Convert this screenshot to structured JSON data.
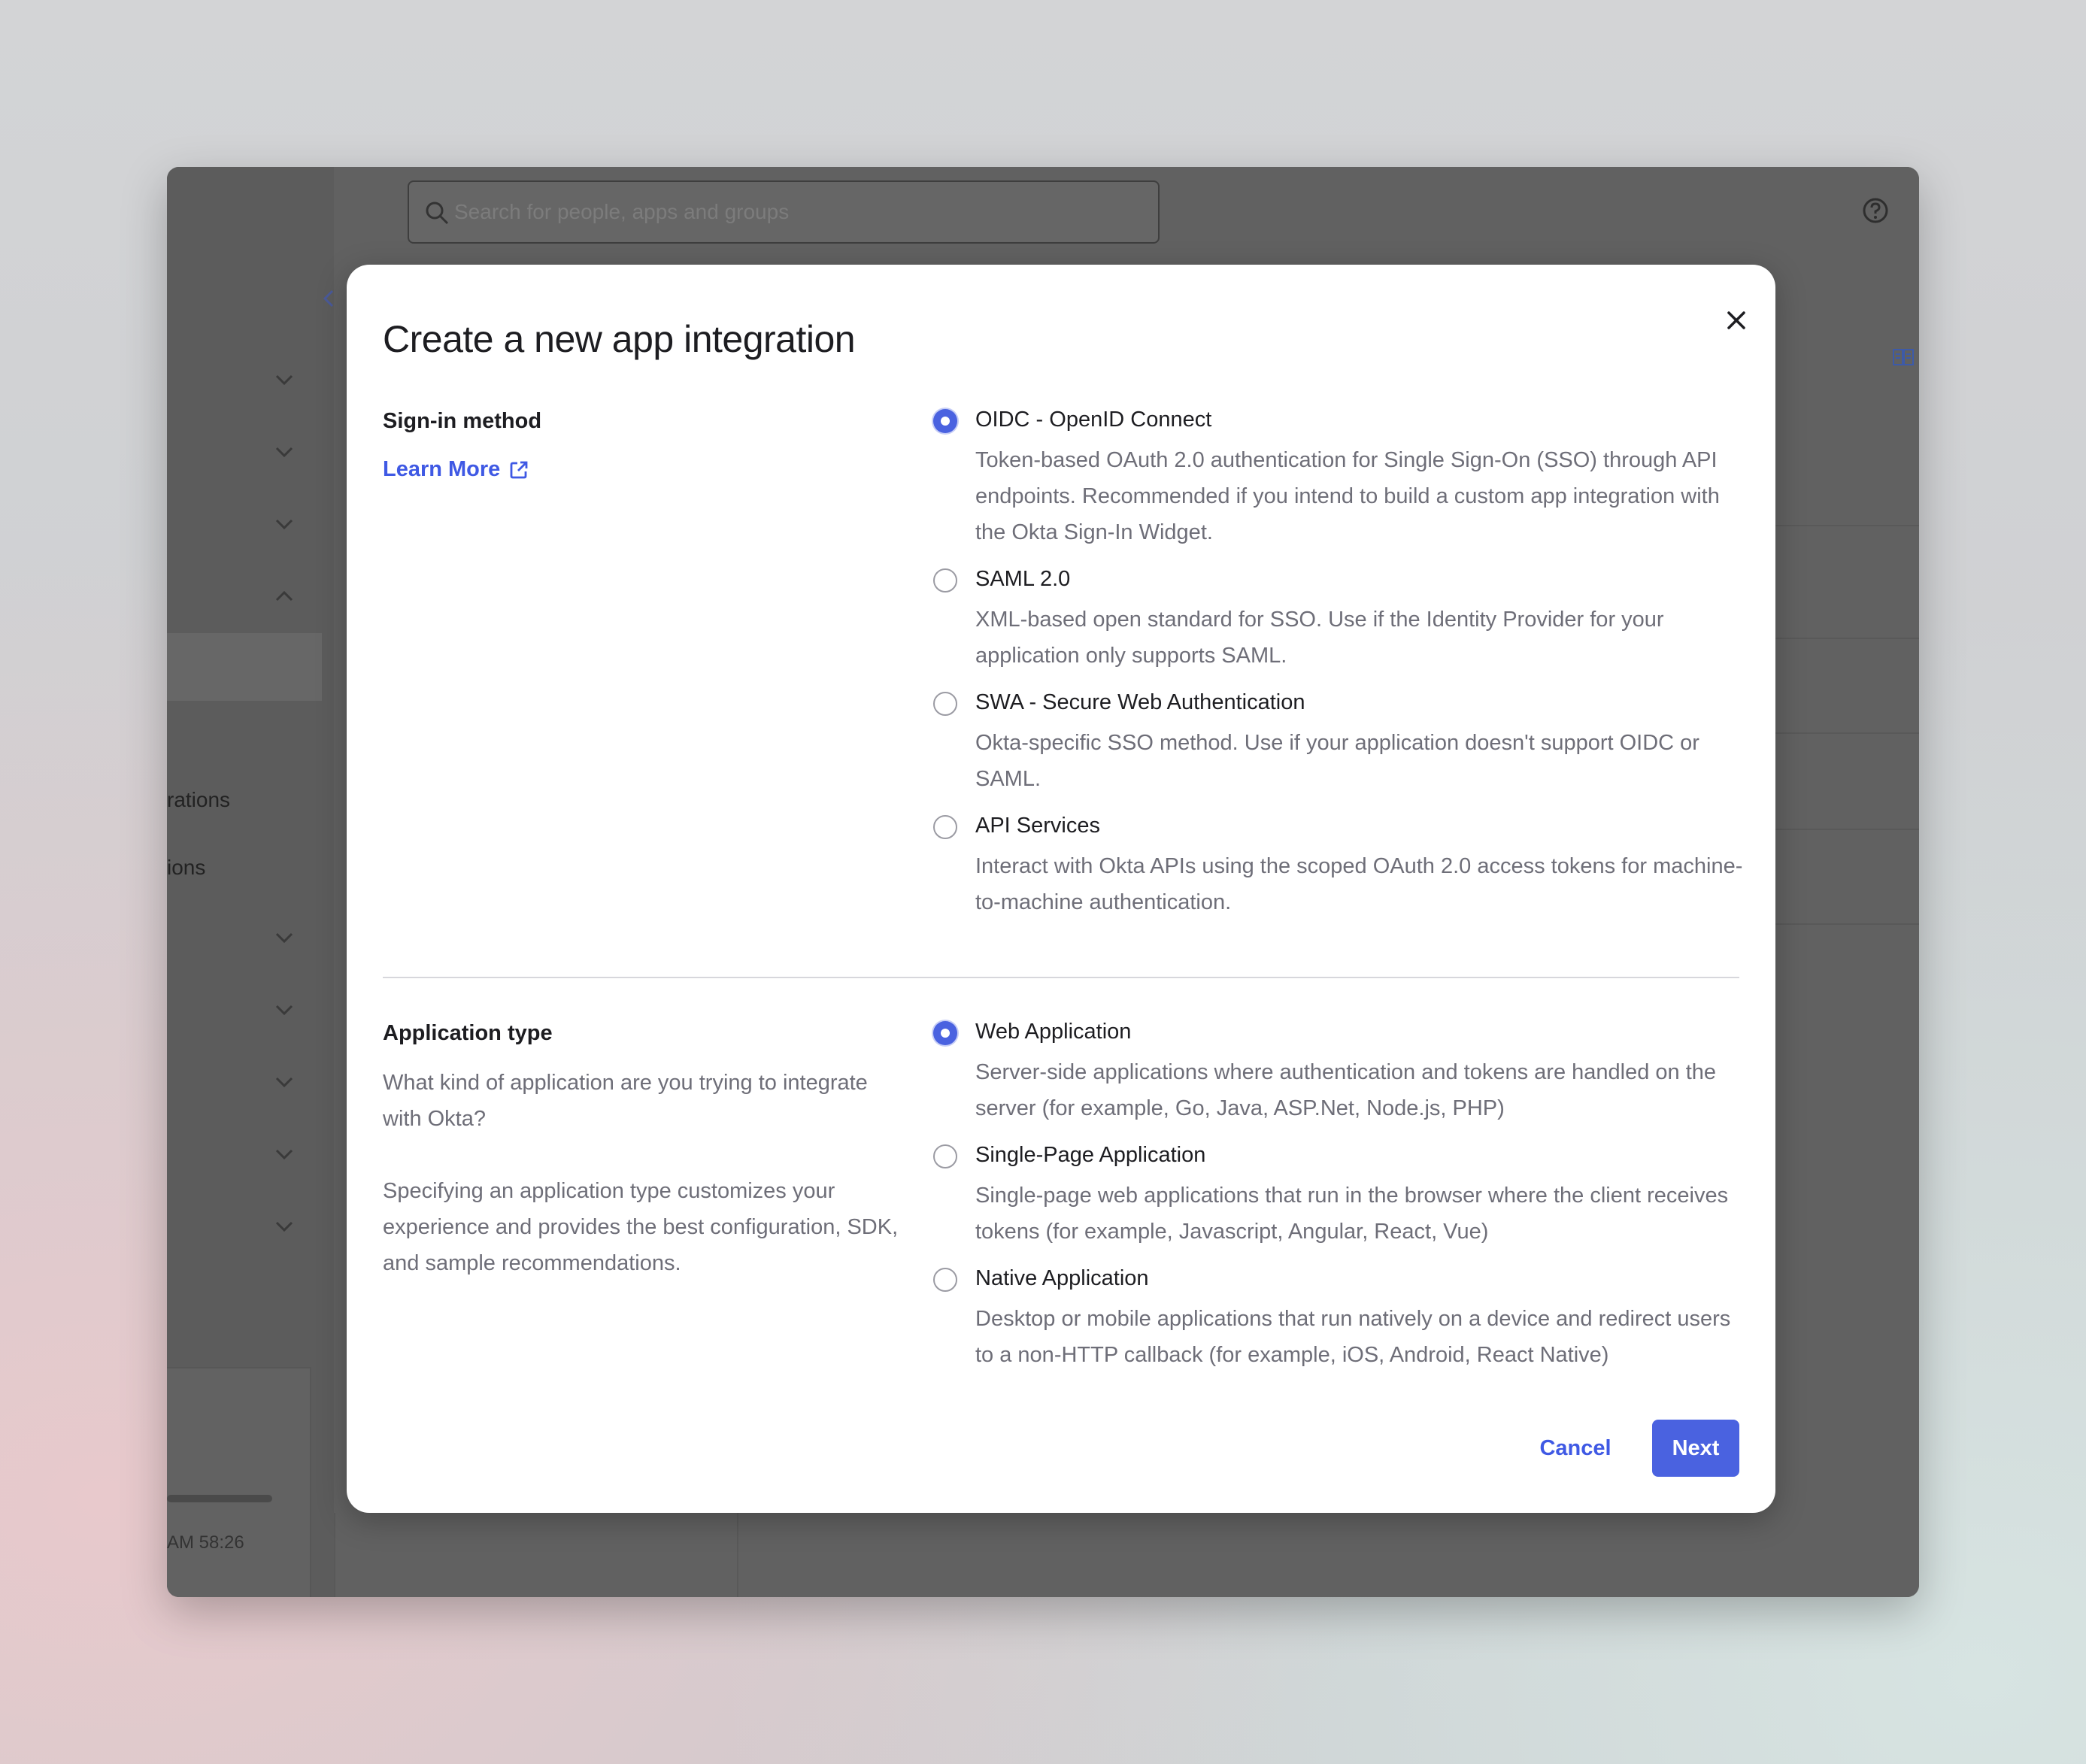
{
  "background": {
    "search_placeholder": "Search for people, apps and groups",
    "sidebar_fragments": [
      "rations",
      "ions"
    ],
    "time_fragment": "58:26 AM"
  },
  "dialog": {
    "title": "Create a new app integration",
    "sign_in": {
      "label": "Sign-in method",
      "learn_more": "Learn More",
      "options": [
        {
          "label": "OIDC - OpenID Connect",
          "description": "Token-based OAuth 2.0 authentication for Single Sign-On (SSO) through API endpoints. Recommended if you intend to build a custom app integration with the Okta Sign-In Widget.",
          "selected": true
        },
        {
          "label": "SAML 2.0",
          "description": "XML-based open standard for SSO. Use if the Identity Provider for your application only supports SAML.",
          "selected": false
        },
        {
          "label": "SWA - Secure Web Authentication",
          "description": "Okta-specific SSO method. Use if your application doesn't support OIDC or SAML.",
          "selected": false
        },
        {
          "label": "API Services",
          "description": "Interact with Okta APIs using the scoped OAuth 2.0 access tokens for machine-to-machine authentication.",
          "selected": false
        }
      ]
    },
    "app_type": {
      "label": "Application type",
      "help_1": "What kind of application are you trying to integrate with Okta?",
      "help_2": "Specifying an application type customizes your experience and provides the best configuration, SDK, and sample recommendations.",
      "options": [
        {
          "label": "Web Application",
          "description": "Server-side applications where authentication and tokens are handled on the server (for example, Go, Java, ASP.Net, Node.js, PHP)",
          "selected": true
        },
        {
          "label": "Single-Page Application",
          "description": "Single-page web applications that run in the browser where the client receives tokens (for example, Javascript, Angular, React, Vue)",
          "selected": false
        },
        {
          "label": "Native Application",
          "description": "Desktop or mobile applications that run natively on a device and redirect users to a non-HTTP callback (for example, iOS, Android, React Native)",
          "selected": false
        }
      ]
    },
    "buttons": {
      "cancel": "Cancel",
      "next": "Next"
    }
  },
  "colors": {
    "accent": "#4a62e0",
    "link": "#3f59e4",
    "overlay": "#5f5f5f"
  }
}
